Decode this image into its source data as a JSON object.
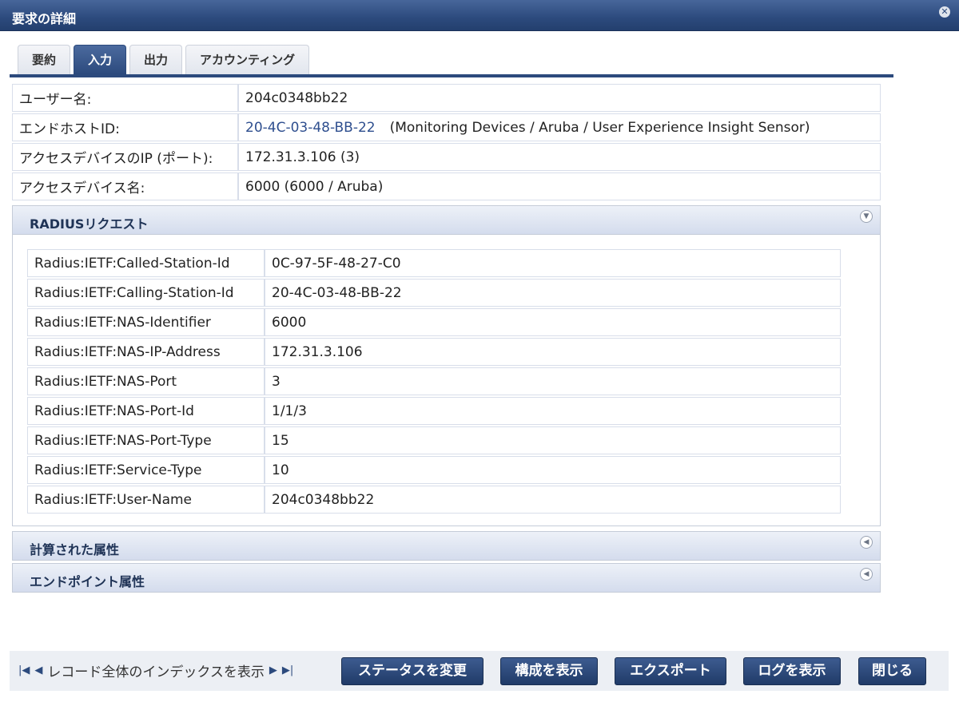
{
  "window": {
    "title": "要求の詳細"
  },
  "tabs": [
    "要約",
    "入力",
    "出力",
    "アカウンティング"
  ],
  "info": {
    "rows": [
      {
        "key": "ユーザー名:",
        "value": "204c0348bb22"
      },
      {
        "key": "エンドホストID:",
        "value": "20-4C-03-48-BB-22",
        "extra": "(Monitoring Devices / Aruba / User Experience Insight Sensor)"
      },
      {
        "key": "アクセスデバイスのIP (ポート):",
        "value": "172.31.3.106 (3)"
      },
      {
        "key": "アクセスデバイス名:",
        "value": "6000 (6000 / Aruba)"
      }
    ]
  },
  "radius": {
    "title": "RADIUSリクエスト",
    "rows": [
      {
        "key": "Radius:IETF:Called-Station-Id",
        "value": "0C-97-5F-48-27-C0"
      },
      {
        "key": "Radius:IETF:Calling-Station-Id",
        "value": "20-4C-03-48-BB-22"
      },
      {
        "key": "Radius:IETF:NAS-Identifier",
        "value": "6000"
      },
      {
        "key": "Radius:IETF:NAS-IP-Address",
        "value": "172.31.3.106"
      },
      {
        "key": "Radius:IETF:NAS-Port",
        "value": "3"
      },
      {
        "key": "Radius:IETF:NAS-Port-Id",
        "value": "1/1/3"
      },
      {
        "key": "Radius:IETF:NAS-Port-Type",
        "value": "15"
      },
      {
        "key": "Radius:IETF:Service-Type",
        "value": "10"
      },
      {
        "key": "Radius:IETF:User-Name",
        "value": "204c0348bb22"
      }
    ]
  },
  "panels": {
    "computed": "計算された属性",
    "endpoint": "エンドポイント属性"
  },
  "footer": {
    "nav_text": "レコード全体のインデックスを表示",
    "buttons": {
      "change_status": "ステータスを変更",
      "show_config": "構成を表示",
      "export": "エクスポート",
      "show_logs": "ログを表示",
      "close": "閉じる"
    }
  }
}
